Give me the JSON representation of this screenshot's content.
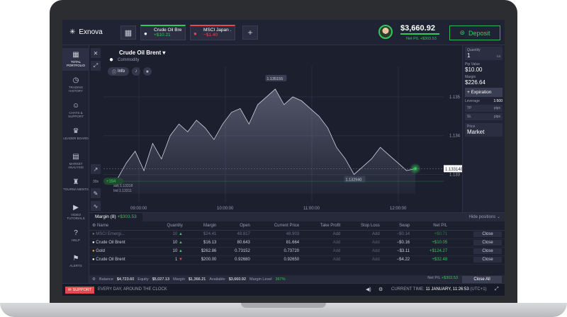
{
  "app": {
    "name": "Exnova"
  },
  "topbar": {
    "tabs": [
      {
        "name": "Crude Oil Bre...",
        "pl": "+$10.21",
        "color": "#34c759"
      },
      {
        "name": "MSCI Japan ...",
        "pl": "−$1.40",
        "color": "#e5484d"
      }
    ],
    "balance": "$3,660.92",
    "net_pl": "Net P/L +$303.53",
    "deposit_label": "Deposit"
  },
  "sidebar": [
    {
      "icon": "portfolio-icon",
      "glyph": "▦",
      "label": "TOTAL PORTFOLIO"
    },
    {
      "icon": "history-icon",
      "glyph": "◷",
      "label": "TRADING HISTORY"
    },
    {
      "icon": "chat-icon",
      "glyph": "☺",
      "label": "CHATS & SUPPORT"
    },
    {
      "icon": "leaderboard-icon",
      "glyph": "♛",
      "label": "LEADER BOARD"
    },
    {
      "icon": "analysis-icon",
      "glyph": "▤",
      "label": "MARKET ANALYSIS"
    },
    {
      "icon": "tournaments-icon",
      "glyph": "♜",
      "label": "TOURNA MENTS"
    },
    {
      "icon": "video-icon",
      "glyph": "▶",
      "label": "VIDEO TUTORIALS"
    },
    {
      "icon": "help-icon",
      "glyph": "?",
      "label": "HELP"
    },
    {
      "icon": "alerts-icon",
      "glyph": "⚑",
      "label": "ALERTS"
    }
  ],
  "chart": {
    "asset": "Crude Oil Brent",
    "category": "Commodity",
    "info_label": "Info",
    "timeframe": "30s",
    "interval": "3h",
    "ask": "ask 1.13318",
    "bid": "bid 1.13311",
    "position_pl": "+394"
  },
  "chart_data": {
    "type": "area",
    "x": [
      "09:00:00",
      "10:00:00",
      "11:00:00",
      "12:00:00"
    ],
    "y_ticks": [
      "1.135",
      "1.134",
      "1.133"
    ],
    "current_price": "1.133148",
    "annotations": [
      "1.135155",
      "1.132940"
    ],
    "values": [
      1.1329,
      1.1333,
      1.1336,
      1.1331,
      1.1338,
      1.1334,
      1.134,
      1.1343,
      1.1341,
      1.1344,
      1.1342,
      1.1339,
      1.1343,
      1.1346,
      1.1347,
      1.1343,
      1.1348,
      1.135,
      1.1352,
      1.1348,
      1.135,
      1.1349,
      1.1347,
      1.1345,
      1.1342,
      1.1337,
      1.1334,
      1.133,
      1.1332,
      1.1334,
      1.1337,
      1.1335,
      1.1333,
      1.1331,
      1.13315
    ],
    "ylim": [
      1.1325,
      1.1356
    ]
  },
  "right_panel": {
    "quantity_label": "Quantity",
    "quantity": "1",
    "quantity_unit": "lot",
    "pip_label": "Pip Value",
    "pip_value": "$10.00",
    "margin_label": "Margin",
    "margin_value": "$226.64",
    "expiration_label": "+ Expiration",
    "leverage_label": "Leverage",
    "leverage_value": "1:500",
    "tp_label": "TP",
    "sl_label": "SL",
    "pips_unit": "pips",
    "price_label": "Price",
    "price_value": "Market"
  },
  "positions": {
    "tab_label": "Margin (8)",
    "tab_pl": "+$303.53",
    "hide_label": "Hide positions",
    "headers": [
      "Name",
      "Quantity",
      "Margin",
      "Open",
      "Current Price",
      "Take Profit",
      "Stop Loss",
      "Swap",
      "Net P/L",
      ""
    ],
    "rows": [
      {
        "name": "MSCI Emergi...",
        "qty": "10",
        "dir": "up",
        "margin": "$24.41",
        "open": "48.817",
        "current": "48.903",
        "tp": "Add",
        "sl": "Add",
        "swap": "−$0.14",
        "pl": "+$0.71",
        "close": "Close",
        "dim": true,
        "color": "#6a6e82"
      },
      {
        "name": "Crude Oil Brent",
        "qty": "10",
        "dir": "up",
        "margin": "$16.13",
        "open": "80.643",
        "current": "81.664",
        "tp": "Add",
        "sl": "Add",
        "swap": "−$0.16",
        "pl": "+$10.05",
        "close": "Close",
        "dim": false,
        "color": "#ffffff"
      },
      {
        "name": "Gold",
        "qty": "10",
        "dir": "up",
        "margin": "$262.86",
        "open": "0.73152",
        "current": "0.73720",
        "tp": "Add",
        "sl": "Add",
        "swap": "−$3.11",
        "pl": "+$124.27",
        "close": "Close",
        "dim": false,
        "color": "#f5a623"
      },
      {
        "name": "Crude Oil Brent",
        "qty": "1",
        "dir": "down",
        "margin": "$200.00",
        "open": "0.92680",
        "current": "0.92650",
        "tp": "Add",
        "sl": "Add",
        "swap": "−$4.22",
        "pl": "+$32.48",
        "close": "Close",
        "dim": false,
        "color": "#ffffff"
      }
    ],
    "summary": {
      "balance_label": "Balance",
      "balance": "$4,723.60",
      "equity_label": "Equity",
      "equity": "$5,027.13",
      "margin_label": "Margin",
      "margin": "$1,366.21",
      "available_label": "Available",
      "available": "$3,660.92",
      "level_label": "Margin Level",
      "level": "367%",
      "net_label": "Net P/L",
      "net": "+$303.53",
      "close_all": "Close All"
    }
  },
  "footer": {
    "support": "SUPPORT",
    "tagline": "EVERY DAY, AROUND THE CLOCK",
    "time_label": "CURRENT TIME:",
    "time_value": "11 JANUARY, 11:26:53",
    "tz": "(UTC+1)"
  }
}
